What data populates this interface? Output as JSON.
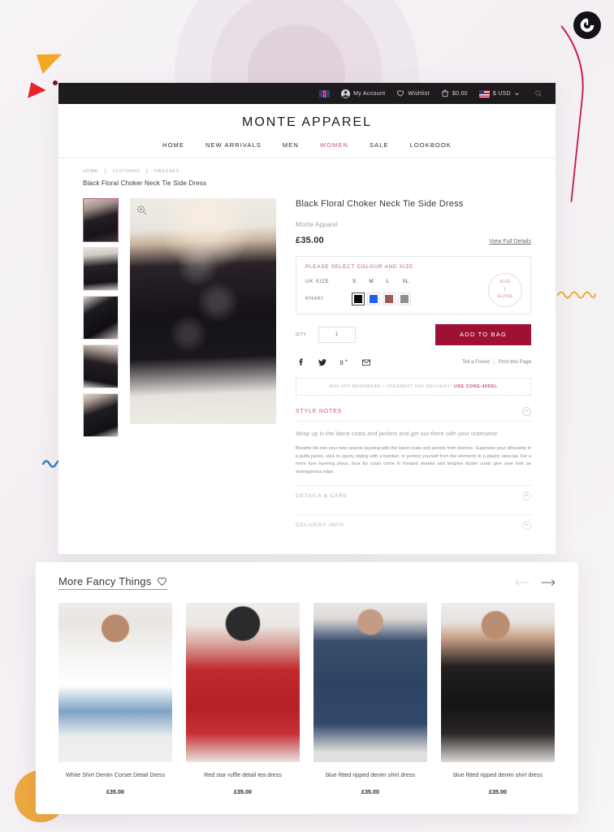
{
  "topbar": {
    "account": "My Account",
    "wishlist": "Wishlist",
    "cart_total": "$0.00",
    "currency": "$ USD"
  },
  "brand": "MONTE APPAREL",
  "nav": [
    {
      "label": "HOME",
      "active": false
    },
    {
      "label": "NEW ARRIVALS",
      "active": false
    },
    {
      "label": "MEN",
      "active": false
    },
    {
      "label": "WOMEN",
      "active": true
    },
    {
      "label": "SALE",
      "active": false
    },
    {
      "label": "LOOKBOOK",
      "active": false
    }
  ],
  "breadcrumb": [
    "HOME",
    "CLOTHING",
    "DRESSES"
  ],
  "product": {
    "name_line": "Black Floral Choker Neck Tie Side Dress",
    "title": "Black Floral Choker Neck Tie Side Dress",
    "brand": "Monte Apparel",
    "price": "£35.00",
    "view_full_details": "View Full Details",
    "select_heading": "PLEASE SELECT COLOUR AND SIZE",
    "size_label": "UK SIZE",
    "sizes": [
      "S",
      "M",
      "L",
      "XL"
    ],
    "colour_label": "KHAKI",
    "swatches": [
      "#0a0a0a",
      "#1f5ff0",
      "#9d5a56",
      "#8d8d8d"
    ],
    "size_guide_line1": "SIZE",
    "size_guide_line2": "GUIDE",
    "qty_label": "QTY",
    "qty_value": "1",
    "add_to_bag": "ADD TO BAG",
    "tell_a_friend": "Tell a Friend",
    "print_page": "Print this Page",
    "promo_text": "40% OFF MENSWEAR + FREENEXT DAY DELIVERY*",
    "promo_code": "USE CODE:40DEL",
    "style_notes_title": "STYLE NOTES",
    "style_notes_lede": "Wrap up in the latest coats and jackets and get out-there with your outerwear",
    "style_notes_body": "Breathe life into your new season layering with the latest coats and jackets from boohoo. Supersize your silhouette in a puffa jacket, stick to sporty styling with a bomber, or protect yourself from the elements in a plastic raincoat. For a more luxe layering piece, faux fur coats come in fondant shades and longline duster coats give your look an androgynous edge.",
    "accordion": [
      {
        "label": "DETAILS & CARE",
        "sign": "+"
      },
      {
        "label": "DELIVERY INFO",
        "sign": "+"
      }
    ],
    "style_notes_sign": "–"
  },
  "carousel": {
    "title": "More Fancy Things",
    "cards": [
      {
        "name": "White Shirt Denim Corset Detail Dress",
        "price": "£35.00"
      },
      {
        "name": "Red star ruffle detail tea dress",
        "price": "£35.00"
      },
      {
        "name": "blue fitted ripped denim shirt dress",
        "price": "£35.00"
      },
      {
        "name": "blue fitted ripped denim shirt dress",
        "price": "£35.00"
      }
    ]
  },
  "colors": {
    "accent_pink": "#c0577c",
    "bag_button": "#9e1135",
    "topbar": "#1d1b1e"
  }
}
